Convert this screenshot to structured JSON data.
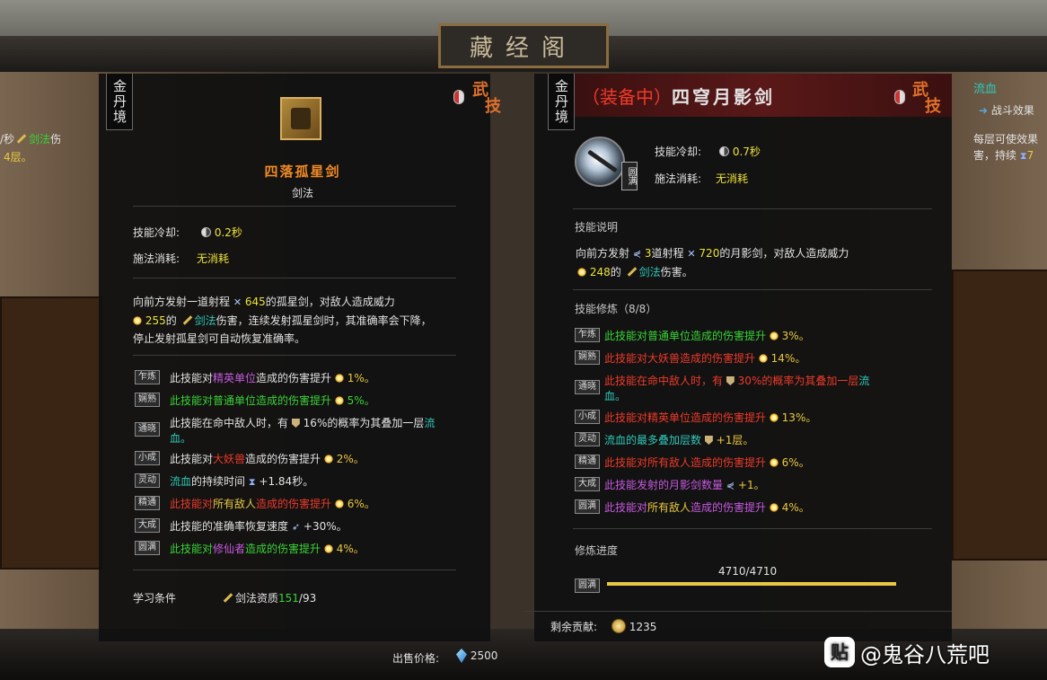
{
  "hall_title": "藏经阁",
  "left_panel": {
    "realm": "金丹境",
    "kind": [
      "武",
      "技"
    ],
    "skill_name": "四落孤星剑",
    "skill_type": "剑法",
    "cooldown_label": "技能冷却:",
    "cooldown_value": "0.2秒",
    "cost_label": "施法消耗:",
    "cost_value": "无消耗",
    "desc": {
      "l1a": "向前方发射一道射程",
      "l1b": "645",
      "l1c": "的孤星剑，对敌人造成威力",
      "l2a": "255",
      "l2b": "的",
      "l2c": "剑法",
      "l2d": "伤害，连续发射孤星剑时，其准确率会下降，",
      "l3": "停止发射孤星剑可自动恢复准确率。"
    },
    "refines": [
      {
        "tag": "乍炼",
        "a": "此技能对",
        "b": "精英单位",
        "c": "造成的伤害提升",
        "d": "1%。"
      },
      {
        "tag": "娴熟",
        "a": "此技能对普通单位造成的伤害提升",
        "d": "5%。"
      },
      {
        "tag": "通晓",
        "a": "此技能在命中敌人时，有",
        "b": "16%的概率为其叠加一层",
        "c": "流",
        "c2": "血。"
      },
      {
        "tag": "小成",
        "a": "此技能对",
        "b": "大妖兽",
        "c": "造成的伤害提升",
        "d": "2%。"
      },
      {
        "tag": "灵动",
        "a": "流血",
        "b": "的持续时间",
        "d": "+1.84秒。"
      },
      {
        "tag": "精通",
        "a": "此技能对",
        "b": "所有敌人",
        "c": "造成的伤害提升",
        "d": "6%。"
      },
      {
        "tag": "大成",
        "a": "此技能的准确率恢复速度",
        "d": "+30%。"
      },
      {
        "tag": "圆满",
        "a": "此技能对",
        "b": "修仙者",
        "c": "造成的伤害提升",
        "d": "4%。"
      }
    ],
    "learn_label": "学习条件",
    "learn_req": "剑法资质",
    "learn_have": "151",
    "learn_need": "/93"
  },
  "right_panel": {
    "realm": "金丹境",
    "equipped": "（装备中）",
    "skill_name": "四穹月影剑",
    "kind": [
      "武",
      "技"
    ],
    "mastery_tag": "圆满",
    "cooldown_label": "技能冷却:",
    "cooldown_value": "0.7秒",
    "cost_label": "施法消耗:",
    "cost_value": "无消耗",
    "desc_title": "技能说明",
    "desc": {
      "l1a": "向前方发射",
      "l1b": "3",
      "l1c": "道射程",
      "l1d": "720",
      "l1e": "的月影剑，对敌人造成威力",
      "l2a": "248",
      "l2b": "的",
      "l2c": "剑法",
      "l2d": "伤害。"
    },
    "refine_title": "技能修炼（8/8）",
    "refines": [
      {
        "tag": "乍炼",
        "text": "此技能对普通单位造成的伤害提升",
        "val": "3%。"
      },
      {
        "tag": "娴熟",
        "text": "此技能对大妖兽造成的伤害提升",
        "val": "14%。"
      },
      {
        "tag": "通晓",
        "text": "此技能在命中敌人时，有",
        "val": "30%的概率为其叠加一层",
        "tail": "流",
        "tail2": "血。"
      },
      {
        "tag": "小成",
        "text": "此技能对精英单位造成的伤害提升",
        "val": "13%。"
      },
      {
        "tag": "灵动",
        "text": "流血的最多叠加层数",
        "val": "+1层。"
      },
      {
        "tag": "精通",
        "text": "此技能对所有敌人造成的伤害提升",
        "val": "6%。"
      },
      {
        "tag": "大成",
        "text": "此技能发射的月影剑数量",
        "val": "+1。"
      },
      {
        "tag": "圆满",
        "a": "此技能对",
        "b": "所有敌人",
        "c": "造成的伤害提升",
        "val": "4%。"
      }
    ],
    "progress_title": "修炼进度",
    "progress_text": "4710/4710",
    "progress_fraction": 1.0,
    "progress_tag": "圆满",
    "remain_label": "剩余贡献:",
    "remain_value": "1235"
  },
  "sale": {
    "label": "出售价格:",
    "value": "2500"
  },
  "side_left": {
    "l1a": "/秒",
    "l1b": "剑法",
    "l1c": "伤",
    "l2": "4层。"
  },
  "side_right": {
    "title": "流血",
    "sub": "战斗效果",
    "l1": "每层可使效果",
    "l2": "害，持续"
  },
  "watermark": {
    "logo": "贴",
    "text": "@鬼谷八荒吧"
  }
}
